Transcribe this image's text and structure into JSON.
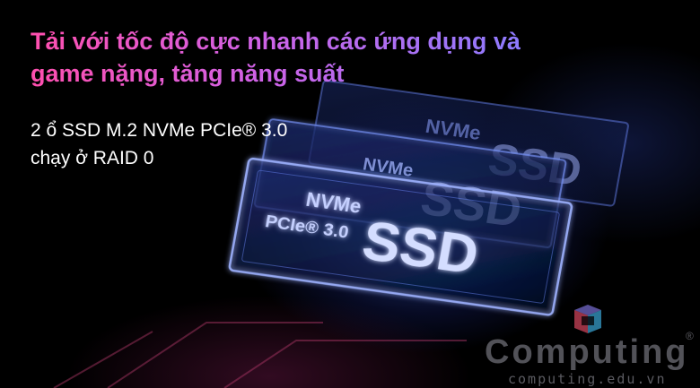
{
  "banner": {
    "headline_line1": "Tải với tốc độ cực nhanh các ứng dụng và",
    "headline_line2": "game nặng, tăng năng suất",
    "spec_line1": "2 ổ SSD M.2 NVMe PCIe® 3.0",
    "spec_line2": "chạy ở RAID 0"
  },
  "ssd_cards": [
    {
      "brand": "NVMe",
      "interface": "",
      "label": "SSD"
    },
    {
      "brand": "NVMe",
      "interface": "",
      "label": "SSD"
    },
    {
      "brand": "NVMe",
      "interface": "PCIe® 3.0",
      "label": "SSD"
    }
  ],
  "watermark": {
    "word": "Computing",
    "registered": "®",
    "url": "computing.edu.vn",
    "icon": "computing-logo-icon"
  },
  "colors": {
    "headline_start": "#ff4fae",
    "headline_end": "#8a7cff",
    "text": "#ffffff",
    "glow": "#4f7dff",
    "background": "#000000"
  }
}
